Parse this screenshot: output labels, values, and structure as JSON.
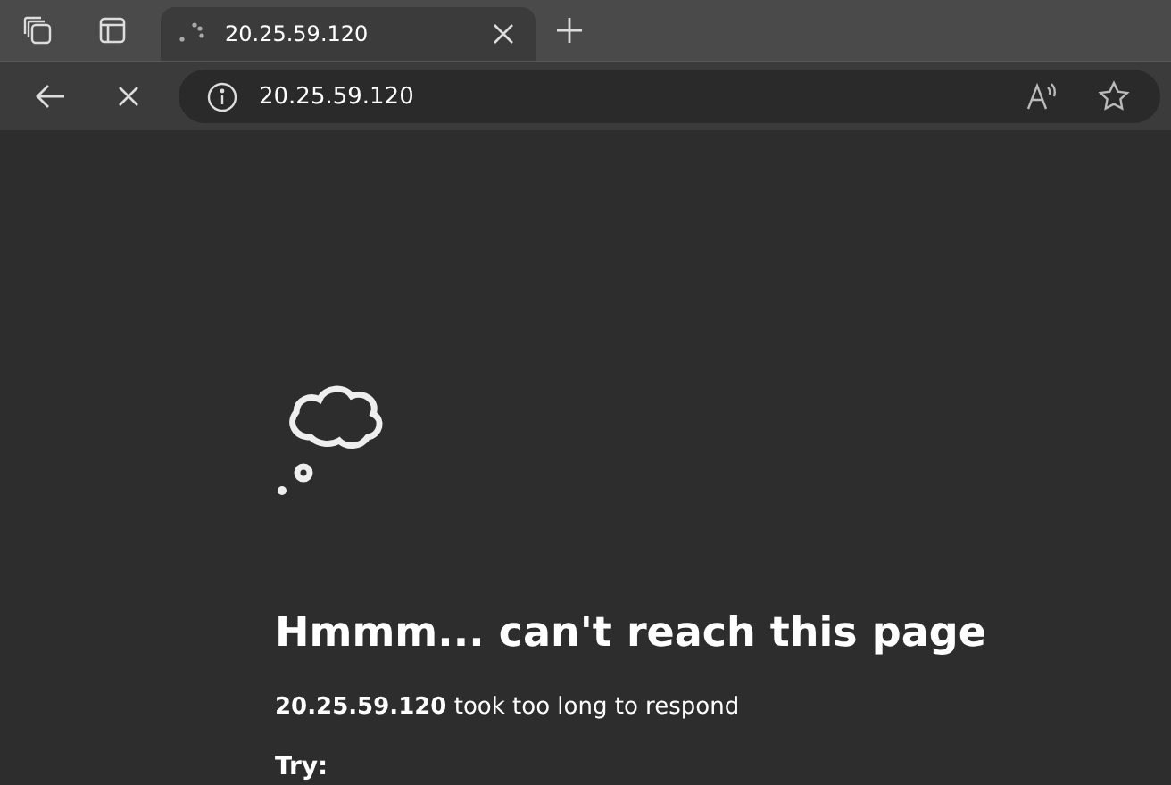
{
  "tabs": [
    {
      "title": "20.25.59.120",
      "selected": true,
      "loading": true
    }
  ],
  "address_bar": {
    "value": "20.25.59.120"
  },
  "error_page": {
    "heading": "Hmmm... can't reach this page",
    "message": "**20.25.59.120** took too long to respond",
    "try_label": "Try:"
  }
}
